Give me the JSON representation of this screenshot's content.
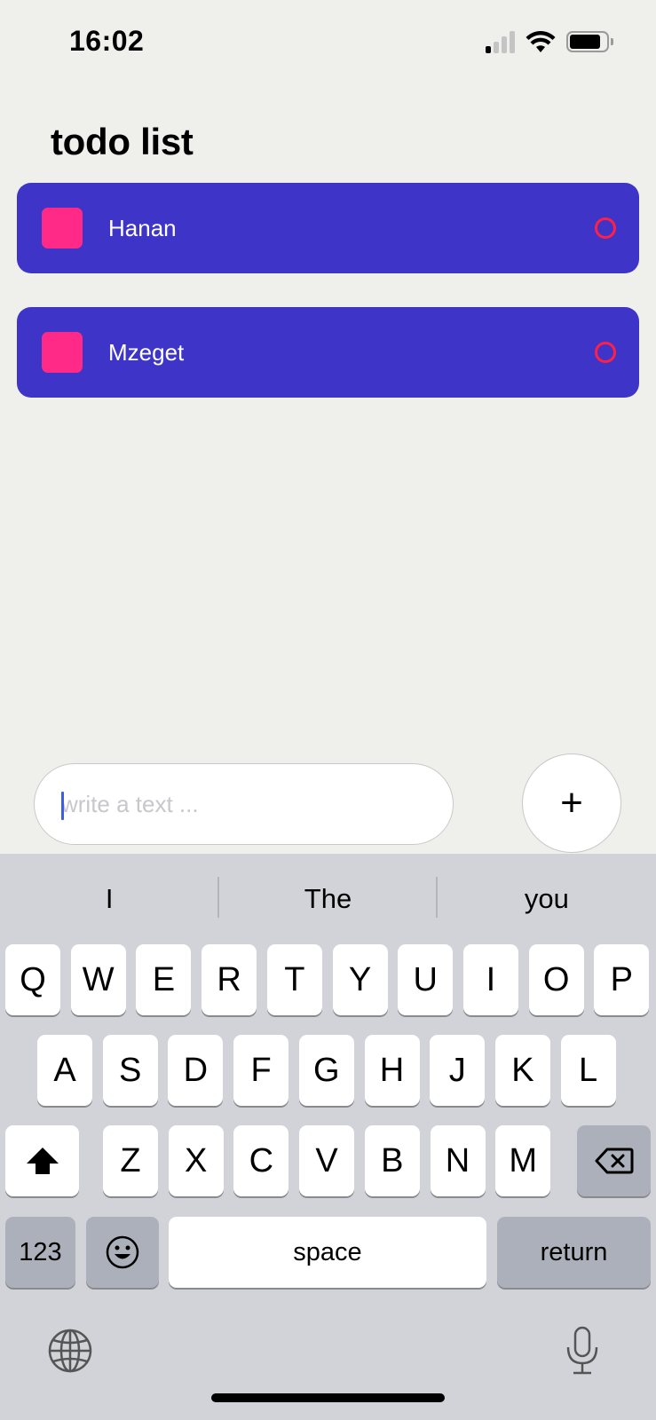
{
  "status_bar": {
    "time": "16:02"
  },
  "app": {
    "title": "todo list",
    "todos": [
      {
        "label": "Hanan"
      },
      {
        "label": "Mzeget"
      }
    ],
    "input": {
      "placeholder": "write a text ...",
      "value": ""
    },
    "add_button": "+"
  },
  "colors": {
    "background": "#efefeb",
    "todo_item_bg": "#3e35c8",
    "checkbox": "#ff2a87",
    "status_ring": "#ff1f47"
  },
  "keyboard": {
    "suggestions": [
      "I",
      "The",
      "you"
    ],
    "row1": [
      "Q",
      "W",
      "E",
      "R",
      "T",
      "Y",
      "U",
      "I",
      "O",
      "P"
    ],
    "row2": [
      "A",
      "S",
      "D",
      "F",
      "G",
      "H",
      "J",
      "K",
      "L"
    ],
    "row3": [
      "Z",
      "X",
      "C",
      "V",
      "B",
      "N",
      "M"
    ],
    "numbers_key": "123",
    "space_key": "space",
    "return_key": "return"
  }
}
